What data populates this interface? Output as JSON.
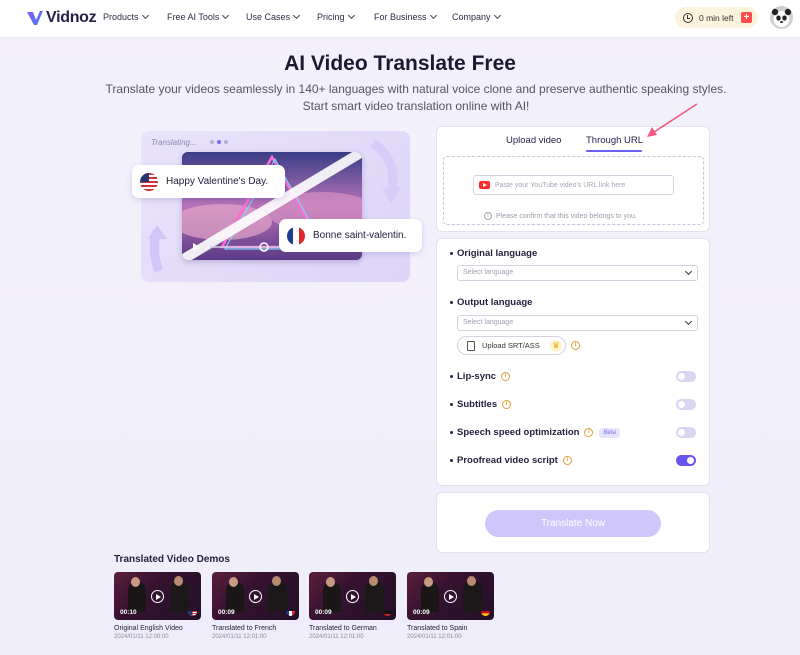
{
  "nav": {
    "logo": "Vidnoz",
    "items": [
      {
        "label": "Products"
      },
      {
        "label": "Free AI Tools"
      },
      {
        "label": "Use Cases"
      },
      {
        "label": "Pricing"
      },
      {
        "label": "For Business"
      },
      {
        "label": "Company"
      }
    ],
    "credits": "0 min left",
    "credits_plus": "+"
  },
  "hero": {
    "title": "AI Video Translate Free",
    "subtitle": "Translate your videos seamlessly in 140+ languages with natural voice clone and preserve authentic speaking styles. Start smart video translation online with AI!"
  },
  "illustration": {
    "status": "Translating...",
    "bubble_en": "Happy Valentine's Day.",
    "bubble_fr": "Bonne saint-valentin."
  },
  "form": {
    "tabs": [
      {
        "label": "Upload video",
        "active": false
      },
      {
        "label": "Through URL",
        "active": true
      }
    ],
    "url_placeholder": "Paste your YouTube video's URL link here",
    "confirm_note": "Please confirm that this video belongs to you.",
    "original_language_label": "Original language",
    "original_language_placeholder": "Select language",
    "output_language_label": "Output language",
    "output_language_placeholder": "Select language",
    "upload_srt_label": "Upload SRT/ASS",
    "options": [
      {
        "label": "Lip-sync",
        "enabled": false,
        "beta": ""
      },
      {
        "label": "Subtitles",
        "enabled": false,
        "beta": ""
      },
      {
        "label": "Speech speed optimization",
        "enabled": false,
        "beta": "Beta"
      },
      {
        "label": "Proofread video script",
        "enabled": true,
        "beta": ""
      }
    ],
    "translate_button": "Translate Now"
  },
  "demos": {
    "title": "Translated Video Demos",
    "items": [
      {
        "name": "Original English Video",
        "date": "2024/01/11 12:00:00",
        "duration": "00:10",
        "flag": "us-flag"
      },
      {
        "name": "Translated to French",
        "date": "2024/01/11 12:01:00",
        "duration": "00:09",
        "flag": "fr-flag"
      },
      {
        "name": "Translated to German",
        "date": "2024/01/11 12:01:00",
        "duration": "00:09",
        "flag": "de-flag"
      },
      {
        "name": "Translated to Spain",
        "date": "2024/01/11 12:01:00",
        "duration": "00:09",
        "flag": "es-flag"
      }
    ]
  },
  "colors": {
    "accent": "#6b5ef0",
    "button_disabled": "#cfc6fb",
    "annotation_arrow": "#f05a7e"
  }
}
